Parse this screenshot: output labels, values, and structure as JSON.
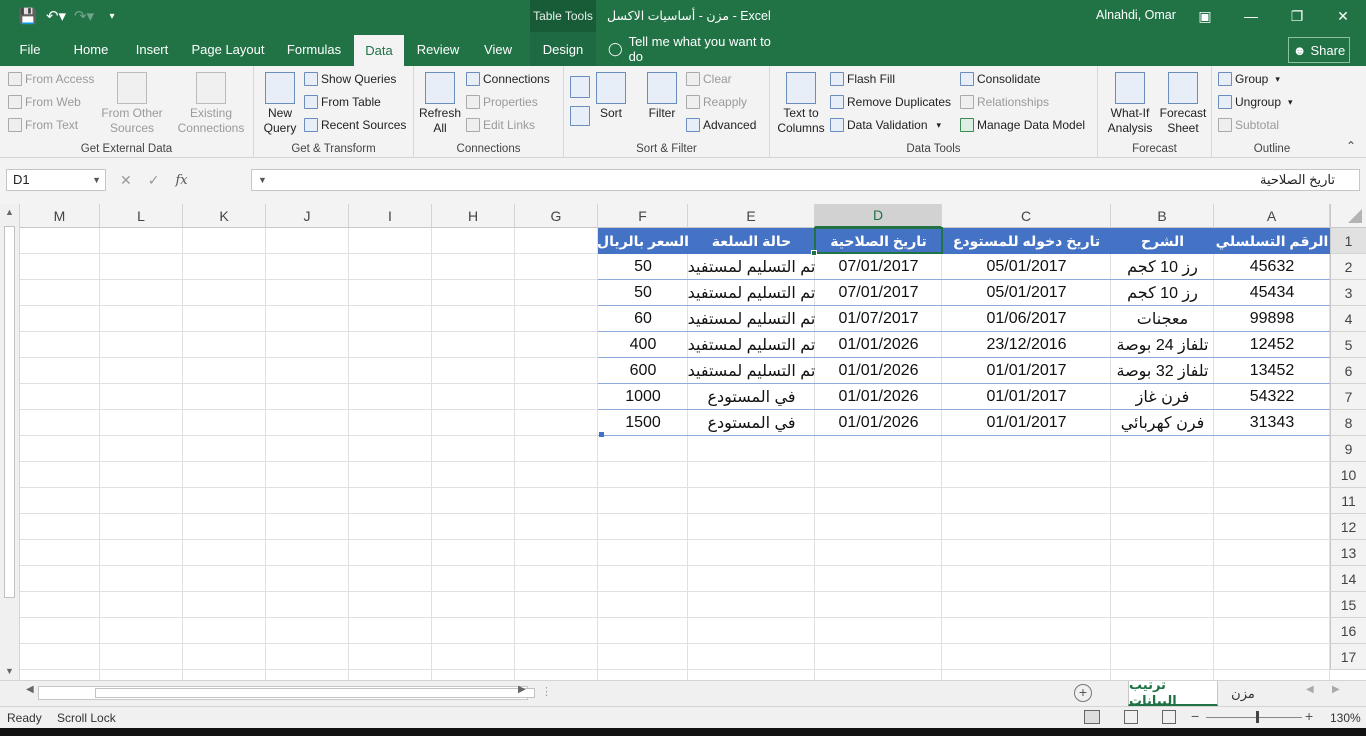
{
  "window": {
    "context_tab": "Table Tools",
    "title": "مزن - أساسيات الاكسل - Excel",
    "user": "Alnahdi, Omar"
  },
  "tabs": [
    "File",
    "Home",
    "Insert",
    "Page Layout",
    "Formulas",
    "Data",
    "Review",
    "View",
    "Design"
  ],
  "tell_me": "Tell me what you want to do",
  "share": "Share",
  "ribbon": {
    "get_external": {
      "from_access": "From Access",
      "from_web": "From Web",
      "from_text": "From Text",
      "from_other_1": "From Other",
      "from_other_2": "Sources",
      "existing_1": "Existing",
      "existing_2": "Connections",
      "label": "Get External Data"
    },
    "get_transform": {
      "new_query_1": "New",
      "new_query_2": "Query",
      "show_queries": "Show Queries",
      "from_table": "From Table",
      "recent_sources": "Recent Sources",
      "label": "Get & Transform"
    },
    "connections": {
      "refresh_1": "Refresh",
      "refresh_2": "All",
      "connections": "Connections",
      "properties": "Properties",
      "edit_links": "Edit Links",
      "label": "Connections"
    },
    "sort_filter": {
      "sort": "Sort",
      "filter": "Filter",
      "clear": "Clear",
      "reapply": "Reapply",
      "advanced": "Advanced",
      "label": "Sort & Filter"
    },
    "data_tools": {
      "text_to_1": "Text to",
      "text_to_2": "Columns",
      "flash_fill": "Flash Fill",
      "remove_duplicates": "Remove Duplicates",
      "data_validation": "Data Validation",
      "consolidate": "Consolidate",
      "relationships": "Relationships",
      "manage_model": "Manage Data Model",
      "label": "Data Tools"
    },
    "forecast": {
      "whatif_1": "What-If",
      "whatif_2": "Analysis",
      "sheet_1": "Forecast",
      "sheet_2": "Sheet",
      "label": "Forecast"
    },
    "outline": {
      "group": "Group",
      "ungroup": "Ungroup",
      "subtotal": "Subtotal",
      "label": "Outline"
    }
  },
  "formula_bar": {
    "name_box": "D1",
    "fx": "fx",
    "formula": "تاريخ الصلاحية"
  },
  "columns": [
    "A",
    "B",
    "C",
    "D",
    "E",
    "F",
    "G",
    "H",
    "I",
    "J",
    "K",
    "L",
    "M"
  ],
  "rows": [
    "1",
    "2",
    "3",
    "4",
    "5",
    "6",
    "7",
    "8",
    "9",
    "10",
    "11",
    "12",
    "13",
    "14",
    "15",
    "16",
    "17"
  ],
  "table": {
    "headers": [
      "الرقم التسلسلي",
      "الشرح",
      "تاريخ دخوله للمستودع",
      "تاريخ الصلاحية",
      "حالة السلعة",
      "السعر بالريال"
    ],
    "rows": [
      [
        "45632",
        "رز 10 كجم",
        "05/01/2017",
        "07/01/2017",
        "تم التسليم لمستفيد",
        "50"
      ],
      [
        "45434",
        "رز 10 كجم",
        "05/01/2017",
        "07/01/2017",
        "تم التسليم لمستفيد",
        "50"
      ],
      [
        "99898",
        "معجنات",
        "01/06/2017",
        "01/07/2017",
        "تم التسليم لمستفيد",
        "60"
      ],
      [
        "12452",
        "تلفاز 24 بوصة",
        "23/12/2016",
        "01/01/2026",
        "تم التسليم لمستفيد",
        "400"
      ],
      [
        "13452",
        "تلفاز 32 بوصة",
        "01/01/2017",
        "01/01/2026",
        "تم التسليم لمستفيد",
        "600"
      ],
      [
        "54322",
        "فرن غاز",
        "01/01/2017",
        "01/01/2026",
        "في المستودع",
        "1000"
      ],
      [
        "31343",
        "فرن كهربائي",
        "01/01/2017",
        "01/01/2026",
        "في المستودع",
        "1500"
      ]
    ]
  },
  "sheets": {
    "active": "ترتيب البيانات",
    "other": "مزن"
  },
  "status": {
    "ready": "Ready",
    "scroll_lock": "Scroll Lock",
    "zoom": "130%"
  },
  "colors": {
    "excel_green": "#217346",
    "table_header": "#4472c4",
    "table_border": "#8ea9db"
  }
}
